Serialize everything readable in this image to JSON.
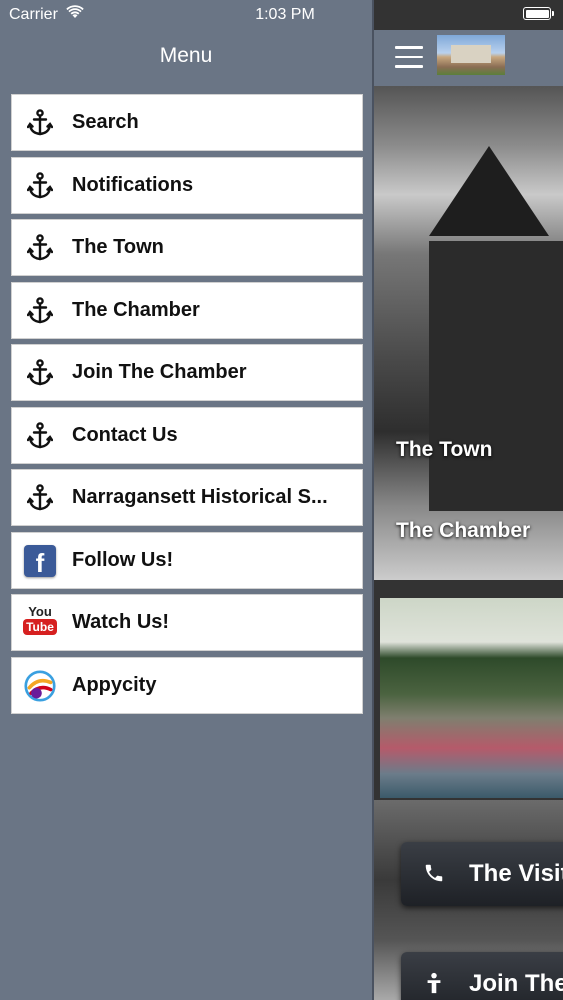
{
  "status_bar": {
    "carrier": "Carrier",
    "time": "1:03 PM"
  },
  "menu": {
    "title": "Menu",
    "items": [
      {
        "label": "Search",
        "icon": "anchor-icon"
      },
      {
        "label": "Notifications",
        "icon": "anchor-icon"
      },
      {
        "label": "The Town",
        "icon": "anchor-icon"
      },
      {
        "label": "The Chamber",
        "icon": "anchor-icon"
      },
      {
        "label": "Join The Chamber",
        "icon": "anchor-icon"
      },
      {
        "label": "Contact Us",
        "icon": "anchor-icon"
      },
      {
        "label": "Narragansett Historical S...",
        "icon": "anchor-icon"
      },
      {
        "label": "Follow Us!",
        "icon": "facebook-icon"
      },
      {
        "label": "Watch Us!",
        "icon": "youtube-icon"
      },
      {
        "label": "Appycity",
        "icon": "appycity-icon"
      }
    ]
  },
  "icons": {
    "facebook_letter": "f",
    "youtube_top": "You",
    "youtube_bottom": "Tube"
  },
  "main": {
    "overlay_labels": [
      "The Town",
      "The Chamber"
    ],
    "buttons": [
      {
        "label": "The Visit",
        "icon": "phone-icon"
      },
      {
        "label": "Join The",
        "icon": "person-icon"
      }
    ]
  },
  "colors": {
    "drawer_bg": "#6a7585",
    "menu_item_bg": "#ffffff",
    "facebook_blue": "#3b5a98",
    "youtube_red": "#d62020"
  }
}
